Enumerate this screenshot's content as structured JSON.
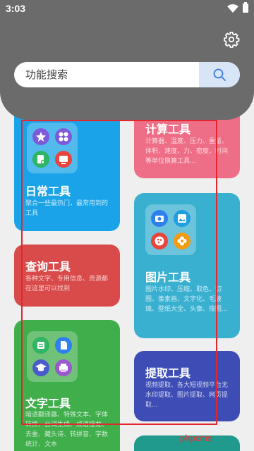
{
  "status_bar": {
    "time": "3:03"
  },
  "search": {
    "placeholder": "功能搜索"
  },
  "cards": {
    "calculator": {
      "title": "计算工具",
      "desc": "计算器、温度、压力、重量、体积、速度、力、密度、时间等单位换算工具..."
    },
    "daily": {
      "title": "日常工具",
      "desc": "聚合一些最热门，最常用到的工具"
    },
    "query": {
      "title": "查询工具",
      "desc": "各种文字、专用信息、资源都在这里可以找到"
    },
    "image": {
      "title": "图片工具",
      "desc": "图片水印、压缩、取色、切图、像素画、文字化、毛玻璃、壁纸大全、头像、搜图..."
    },
    "text": {
      "title": "文字工具",
      "desc": "暗语翻译器、特殊文本、字体转换、台词生成、成语接龙、去重、藏头诗、转拼音、字数统计、文本"
    },
    "extract": {
      "title": "提取工具",
      "desc": "视频提取、各大短视频平台无水印提取、图片提取、网页提取..."
    }
  },
  "colors": {
    "header": "#6b6b6b",
    "daily": "#1aa3e8",
    "calculator": "#ee6e87",
    "query": "#d94a4a",
    "image": "#3ab0d1",
    "text": "#3fae4b",
    "extract": "#3e4db5",
    "teal": "#1f9a8c"
  },
  "watermark": "phpcms"
}
